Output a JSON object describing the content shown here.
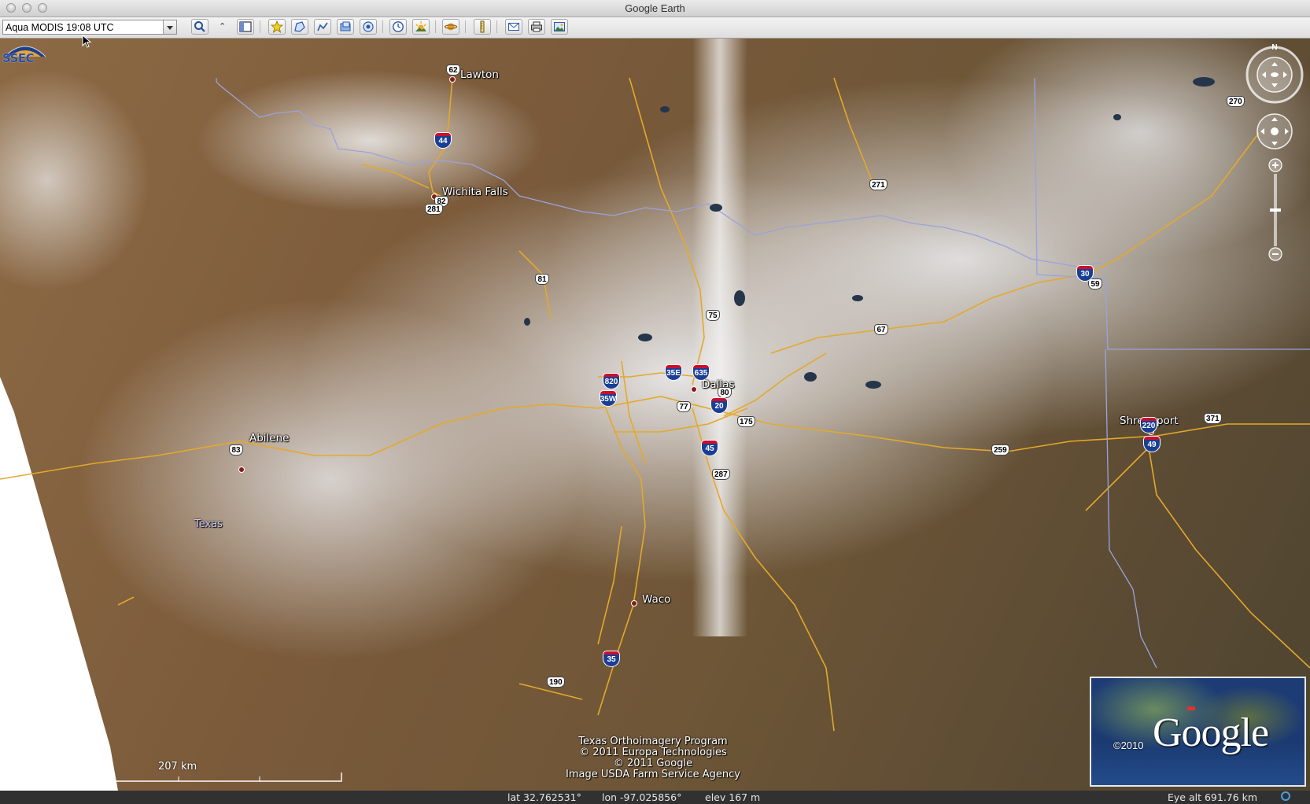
{
  "window": {
    "title": "Google Earth"
  },
  "toolbar": {
    "layer_select_value": "Aqua MODIS 19:08 UTC",
    "buttons": [
      "search-icon",
      "collapse-icon",
      "sidebar-toggle-icon",
      "placemark-icon",
      "polygon-icon",
      "path-icon",
      "image-overlay-icon",
      "record-tour-icon",
      "historical-imagery-icon",
      "sunlight-icon",
      "planets-icon",
      "ruler-icon",
      "email-icon",
      "print-icon",
      "save-image-icon"
    ]
  },
  "map": {
    "logo_text": "SSEC",
    "cities": [
      {
        "name": "Lawton"
      },
      {
        "name": "Wichita Falls"
      },
      {
        "name": "Abilene"
      },
      {
        "name": "Dallas"
      },
      {
        "name": "Waco"
      },
      {
        "name": "Shreveport"
      }
    ],
    "state_label": "Texas",
    "us_routes": [
      "62",
      "82",
      "281",
      "81",
      "75",
      "271",
      "67",
      "77",
      "80",
      "175",
      "287",
      "83",
      "259",
      "59",
      "371",
      "270",
      "190"
    ],
    "interstates": [
      "44",
      "820",
      "35W",
      "35E",
      "635",
      "20",
      "45",
      "30",
      "49",
      "35",
      "220"
    ],
    "attribution": [
      "Texas Orthoimagery Program",
      "© 2011 Europa Technologies",
      "© 2011 Google",
      "Image USDA Farm Service Agency"
    ],
    "scale_label": "207 km",
    "compass_north": "N",
    "overview_brand": "Google",
    "overview_copyright": "©2010"
  },
  "status": {
    "lat": "lat   32.762531°",
    "lon": "lon  -97.025856°",
    "elev": "elev   167 m",
    "eye_alt": "Eye alt    691.76 km"
  },
  "colors": {
    "road": "#e3a92b",
    "river": "#9aa3dc",
    "statusbar": "#313131"
  }
}
